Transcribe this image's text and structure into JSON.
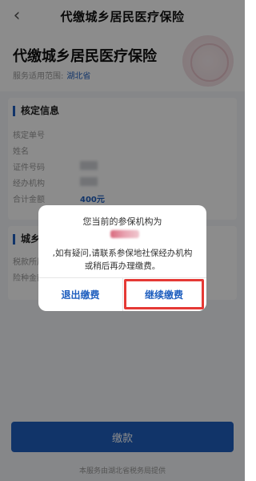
{
  "nav": {
    "title": "代缴城乡居民医疗保险",
    "back_glyph": "‹"
  },
  "hero": {
    "title": "代缴城乡居民医疗保险",
    "scope_label": "服务适用范围:",
    "province": "湖北省"
  },
  "verify_section": {
    "title": "核定信息",
    "rows": [
      {
        "label": "核定单号",
        "value": ""
      },
      {
        "label": "姓名",
        "value": ""
      },
      {
        "label": "证件号码",
        "value": ""
      },
      {
        "label": "经办机构",
        "value": ""
      },
      {
        "label": "合计金额",
        "value": "400元"
      }
    ]
  },
  "insurance_section": {
    "title": "城乡居民基本医疗保险",
    "rows": [
      {
        "label": "税款所属期",
        "value": ""
      },
      {
        "label": "险种金额",
        "value": ""
      }
    ]
  },
  "pay_button": {
    "label": "缴款"
  },
  "footer": {
    "note": "本服务由湖北省税务局提供"
  },
  "dialog": {
    "line1": "您当前的参保机构为",
    "line2": ",如有疑问,请联系参保地社保经办机构或稍后再办理缴费。",
    "exit_label": "退出缴费",
    "continue_label": "继续缴费"
  },
  "colors": {
    "accent": "#1f5fbf",
    "highlight": "#e53935"
  }
}
